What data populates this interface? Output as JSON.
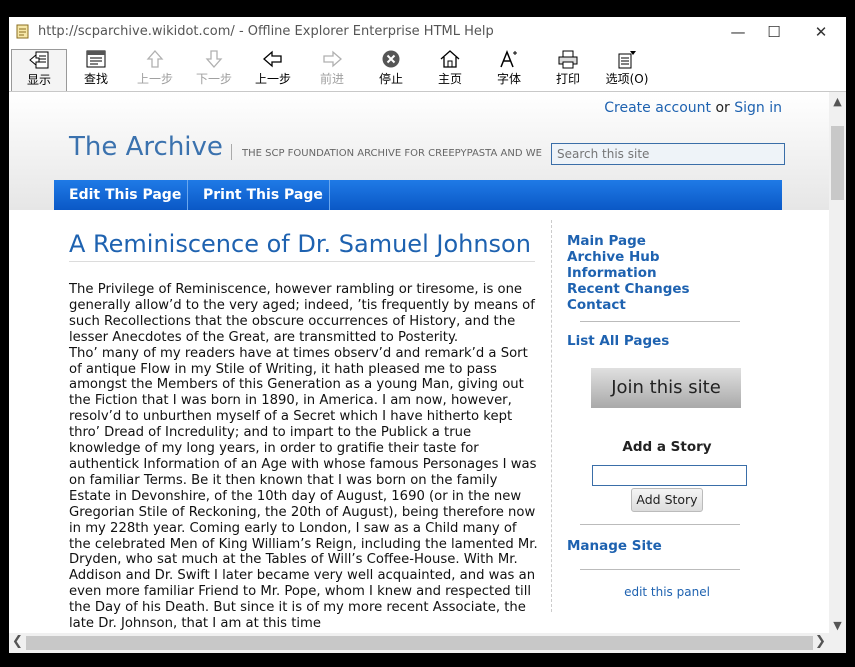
{
  "window": {
    "title": "http://scparchive.wikidot.com/ - Offline Explorer Enterprise HTML Help",
    "controls": {
      "minimize": "—",
      "maximize": "☐",
      "close": "✕"
    }
  },
  "toolbar": {
    "items": [
      {
        "label": "显示",
        "icon": "show-icon",
        "enabled": true,
        "active": true
      },
      {
        "label": "查找",
        "icon": "find-icon",
        "enabled": true
      },
      {
        "label": "上一步",
        "icon": "up-arrow-icon",
        "enabled": false
      },
      {
        "label": "下一步",
        "icon": "down-arrow-icon",
        "enabled": false
      },
      {
        "label": "上一步",
        "icon": "back-arrow-icon",
        "enabled": true
      },
      {
        "label": "前进",
        "icon": "forward-arrow-icon",
        "enabled": false
      },
      {
        "label": "停止",
        "icon": "stop-icon",
        "enabled": true
      },
      {
        "label": "主页",
        "icon": "home-icon",
        "enabled": true
      },
      {
        "label": "字体",
        "icon": "font-icon",
        "enabled": true
      },
      {
        "label": "打印",
        "icon": "print-icon",
        "enabled": true
      },
      {
        "label": "选项(O)",
        "icon": "options-icon",
        "enabled": true
      }
    ]
  },
  "site": {
    "create_account": "Create account",
    "or": "or",
    "sign_in": "Sign in",
    "title": "The Archive",
    "subtitle": "THE SCP FOUNDATION ARCHIVE FOR CREEPYPASTA AND WE",
    "search_placeholder": "Search this site",
    "nav": {
      "edit": "Edit This Page",
      "print": "Print This Page"
    }
  },
  "article": {
    "title": "A Reminiscence of Dr. Samuel Johnson",
    "paragraphs": [
      "The Privilege of Reminiscence, however rambling or tiresome, is one generally allow’d to the very aged; indeed, ’tis frequently by means of such Recollections that the obscure occurrences of History, and the lesser Anecdotes of the Great, are transmitted to Posterity.",
      "Tho’ many of my readers have at times observ’d and remark’d a Sort of antique Flow in my Stile of Writing, it hath pleased me to pass amongst the Members of this Generation as a young Man, giving out the Fiction that I was born in 1890, in America. I am now, however, resolv’d to unburthen myself of a Secret which I have hitherto kept thro’ Dread of Incredulity; and to impart to the Publick a true knowledge of my long years, in order to gratifie their taste for authentick Information of an Age with whose famous Personages I was on familiar Terms. Be it then known that I was born on the family Estate in Devonshire, of the 10th day of August, 1690 (or in the new Gregorian Stile of Reckoning, the 20th of August), being therefore now in my 228th year. Coming early to London, I saw as a Child many of the celebrated Men of King William’s Reign, including the lamented Mr. Dryden, who sat much at the Tables of Will’s Coffee-House. With Mr. Addison and Dr. Swift I later became very well acquainted, and was an even more familiar Friend to Mr. Pope, whom I knew and respected till the Day of his Death. But since it is of my more recent Associate, the late Dr. Johnson, that I am at this time"
    ]
  },
  "sidebar": {
    "links": [
      "Main Page",
      "Archive Hub",
      "Information",
      "Recent Changes",
      "Contact"
    ],
    "list_all": "List All Pages",
    "join": "Join this site",
    "add_story_title": "Add a Story",
    "add_story_button": "Add Story",
    "manage": "Manage Site",
    "edit_panel": "edit this panel"
  }
}
